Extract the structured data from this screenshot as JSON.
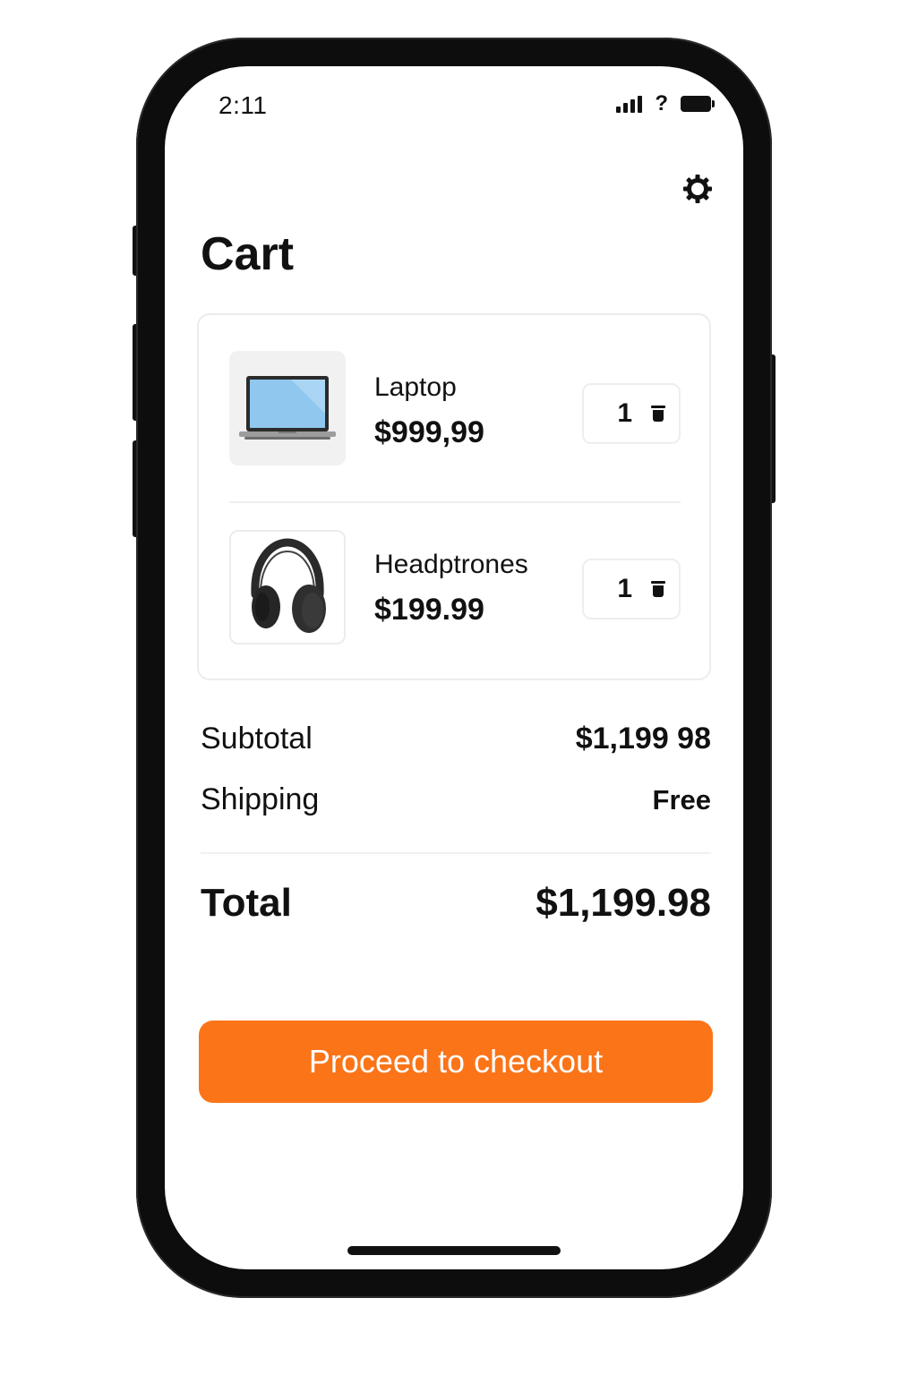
{
  "status_bar": {
    "time": "2:11"
  },
  "header": {
    "title": "Cart",
    "settings_icon": "gear-icon"
  },
  "cart": {
    "items": [
      {
        "name": "Laptop",
        "price": "$999,99",
        "quantity": "1",
        "image_icon": "laptop-image",
        "remove_icon": "trash-icon"
      },
      {
        "name": "Headptrones",
        "price": "$199.99",
        "quantity": "1",
        "image_icon": "headphones-image",
        "remove_icon": "trash-icon"
      }
    ]
  },
  "summary": {
    "subtotal_label": "Subtotal",
    "subtotal_value": "$1,199 98",
    "shipping_label": "Shipping",
    "shipping_value": "Free",
    "total_label": "Total",
    "total_value": "$1,199.98"
  },
  "checkout": {
    "button_label": "Proceed to checkout",
    "accent_color": "#fb7418"
  }
}
